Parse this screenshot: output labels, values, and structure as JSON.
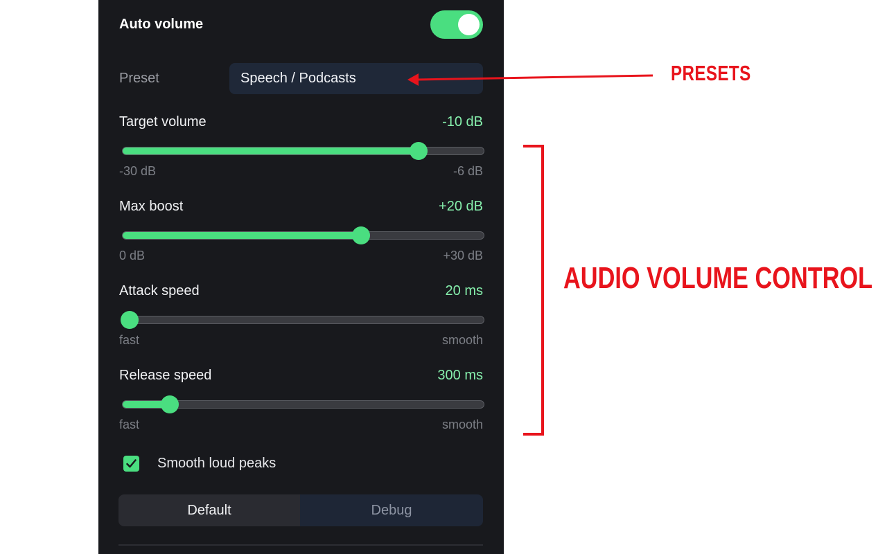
{
  "panel": {
    "title": "Auto volume",
    "toggle_on": true,
    "preset": {
      "label": "Preset",
      "value": "Speech / Podcasts"
    },
    "sliders": [
      {
        "label": "Target volume",
        "value": "-10 dB",
        "min_label": "-30 dB",
        "max_label": "-6 dB",
        "level": 0.82
      },
      {
        "label": "Max boost",
        "value": "+20 dB",
        "min_label": "0 dB",
        "max_label": "+30 dB",
        "level": 0.66
      },
      {
        "label": "Attack speed",
        "value": "20 ms",
        "min_label": "fast",
        "max_label": "smooth",
        "level": 0.02
      },
      {
        "label": "Release speed",
        "value": "300 ms",
        "min_label": "fast",
        "max_label": "smooth",
        "level": 0.13
      }
    ],
    "checkbox": {
      "label": "Smooth loud peaks",
      "checked": true
    },
    "buttons": {
      "default": "Default",
      "debug": "Debug"
    }
  },
  "annotations": {
    "presets": "PRESETS",
    "audio_volume_control": "AUDIO VOLUME CONTROL"
  },
  "colors": {
    "panel_bg": "#18191d",
    "accent": "#4ade80",
    "value_text": "#86efac",
    "annotation": "#e8141c"
  }
}
